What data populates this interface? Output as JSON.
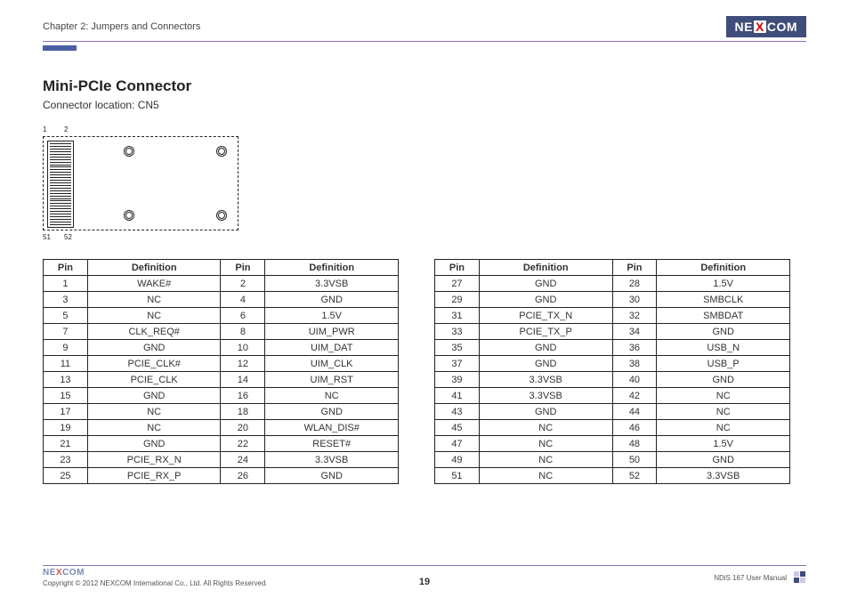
{
  "header": {
    "chapter": "Chapter 2: Jumpers and Connectors",
    "logo_text_left": "NE",
    "logo_text_x": "X",
    "logo_text_right": "COM"
  },
  "content": {
    "heading": "Mini-PCIe Connector",
    "subtext": "Connector location: CN5",
    "pin_labels": {
      "tl": "1",
      "tr": "2",
      "bl": "51",
      "br": "52"
    }
  },
  "table_headers": {
    "pin": "Pin",
    "definition": "Definition"
  },
  "table_left": [
    {
      "p1": "1",
      "d1": "WAKE#",
      "p2": "2",
      "d2": "3.3VSB"
    },
    {
      "p1": "3",
      "d1": "NC",
      "p2": "4",
      "d2": "GND"
    },
    {
      "p1": "5",
      "d1": "NC",
      "p2": "6",
      "d2": "1.5V"
    },
    {
      "p1": "7",
      "d1": "CLK_REQ#",
      "p2": "8",
      "d2": "UIM_PWR"
    },
    {
      "p1": "9",
      "d1": "GND",
      "p2": "10",
      "d2": "UIM_DAT"
    },
    {
      "p1": "11",
      "d1": "PCIE_CLK#",
      "p2": "12",
      "d2": "UIM_CLK"
    },
    {
      "p1": "13",
      "d1": "PCIE_CLK",
      "p2": "14",
      "d2": "UIM_RST"
    },
    {
      "p1": "15",
      "d1": "GND",
      "p2": "16",
      "d2": "NC"
    },
    {
      "p1": "17",
      "d1": "NC",
      "p2": "18",
      "d2": "GND"
    },
    {
      "p1": "19",
      "d1": "NC",
      "p2": "20",
      "d2": "WLAN_DIS#"
    },
    {
      "p1": "21",
      "d1": "GND",
      "p2": "22",
      "d2": "RESET#"
    },
    {
      "p1": "23",
      "d1": "PCIE_RX_N",
      "p2": "24",
      "d2": "3.3VSB"
    },
    {
      "p1": "25",
      "d1": "PCIE_RX_P",
      "p2": "26",
      "d2": "GND"
    }
  ],
  "table_right": [
    {
      "p1": "27",
      "d1": "GND",
      "p2": "28",
      "d2": "1.5V"
    },
    {
      "p1": "29",
      "d1": "GND",
      "p2": "30",
      "d2": "SMBCLK"
    },
    {
      "p1": "31",
      "d1": "PCIE_TX_N",
      "p2": "32",
      "d2": "SMBDAT"
    },
    {
      "p1": "33",
      "d1": "PCIE_TX_P",
      "p2": "34",
      "d2": "GND"
    },
    {
      "p1": "35",
      "d1": "GND",
      "p2": "36",
      "d2": "USB_N"
    },
    {
      "p1": "37",
      "d1": "GND",
      "p2": "38",
      "d2": "USB_P"
    },
    {
      "p1": "39",
      "d1": "3.3VSB",
      "p2": "40",
      "d2": "GND"
    },
    {
      "p1": "41",
      "d1": "3.3VSB",
      "p2": "42",
      "d2": "NC"
    },
    {
      "p1": "43",
      "d1": "GND",
      "p2": "44",
      "d2": "NC"
    },
    {
      "p1": "45",
      "d1": "NC",
      "p2": "46",
      "d2": "NC"
    },
    {
      "p1": "47",
      "d1": "NC",
      "p2": "48",
      "d2": "1.5V"
    },
    {
      "p1": "49",
      "d1": "NC",
      "p2": "50",
      "d2": "GND"
    },
    {
      "p1": "51",
      "d1": "NC",
      "p2": "52",
      "d2": "3.3VSB"
    }
  ],
  "footer": {
    "copyright": "Copyright © 2012 NEXCOM International Co., Ltd. All Rights Reserved.",
    "page_number": "19",
    "manual": "NDiS 167 User Manual"
  }
}
